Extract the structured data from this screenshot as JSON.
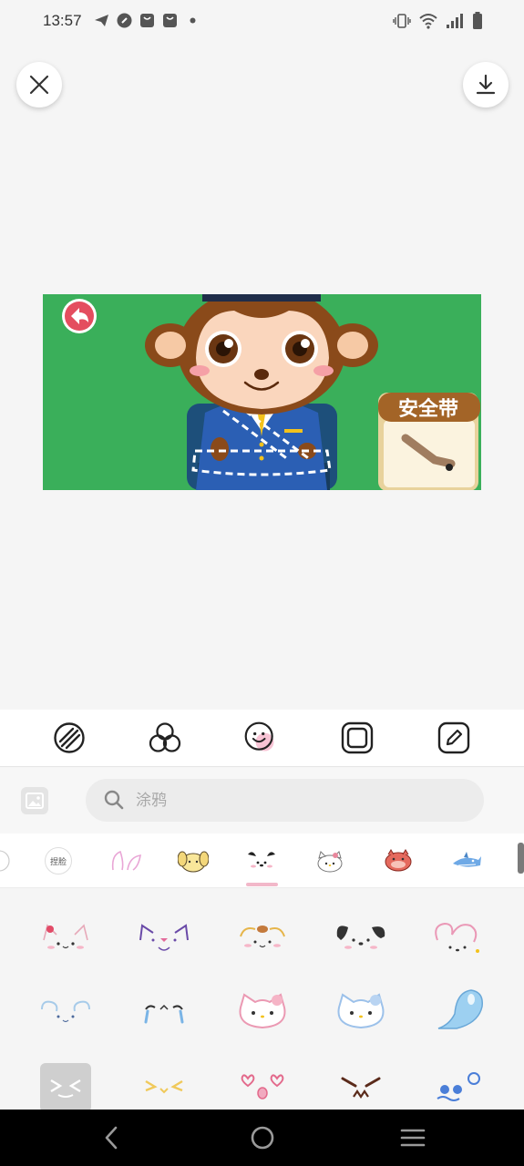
{
  "status": {
    "time": "13:57"
  },
  "preview": {
    "game_label": "安全带"
  },
  "search": {
    "placeholder": "涂鸦"
  },
  "categories": [
    {
      "label": "",
      "icon": "partial-tab-icon"
    },
    {
      "label": "捏脸",
      "icon": "face-text-icon"
    },
    {
      "label": "",
      "icon": "bunny-ears-icon"
    },
    {
      "label": "",
      "icon": "dog-face-icon"
    },
    {
      "label": "",
      "icon": "pochacco-icon",
      "selected": true
    },
    {
      "label": "",
      "icon": "hello-kitty-icon"
    },
    {
      "label": "",
      "icon": "red-monster-icon"
    },
    {
      "label": "",
      "icon": "shark-icon"
    }
  ],
  "stickers": [
    "cat-ears-sticker",
    "purple-cat-sticker",
    "bear-ears-sticker",
    "black-ears-sticker",
    "pink-heart-sticker",
    "cinnamoroll-sticker",
    "crying-face-sticker",
    "hello-kitty-pink-sticker",
    "hello-kitty-blue-sticker",
    "blue-ghost-sticker",
    "gray-box-sticker",
    "squint-face-sticker",
    "heart-eyes-sticker",
    "angry-face-sticker",
    "blue-eyes-sticker"
  ],
  "colors": {
    "preview_bg": "#3aaf5a",
    "accent": "#e46d94",
    "toolbar_bg": "#ffffff"
  }
}
